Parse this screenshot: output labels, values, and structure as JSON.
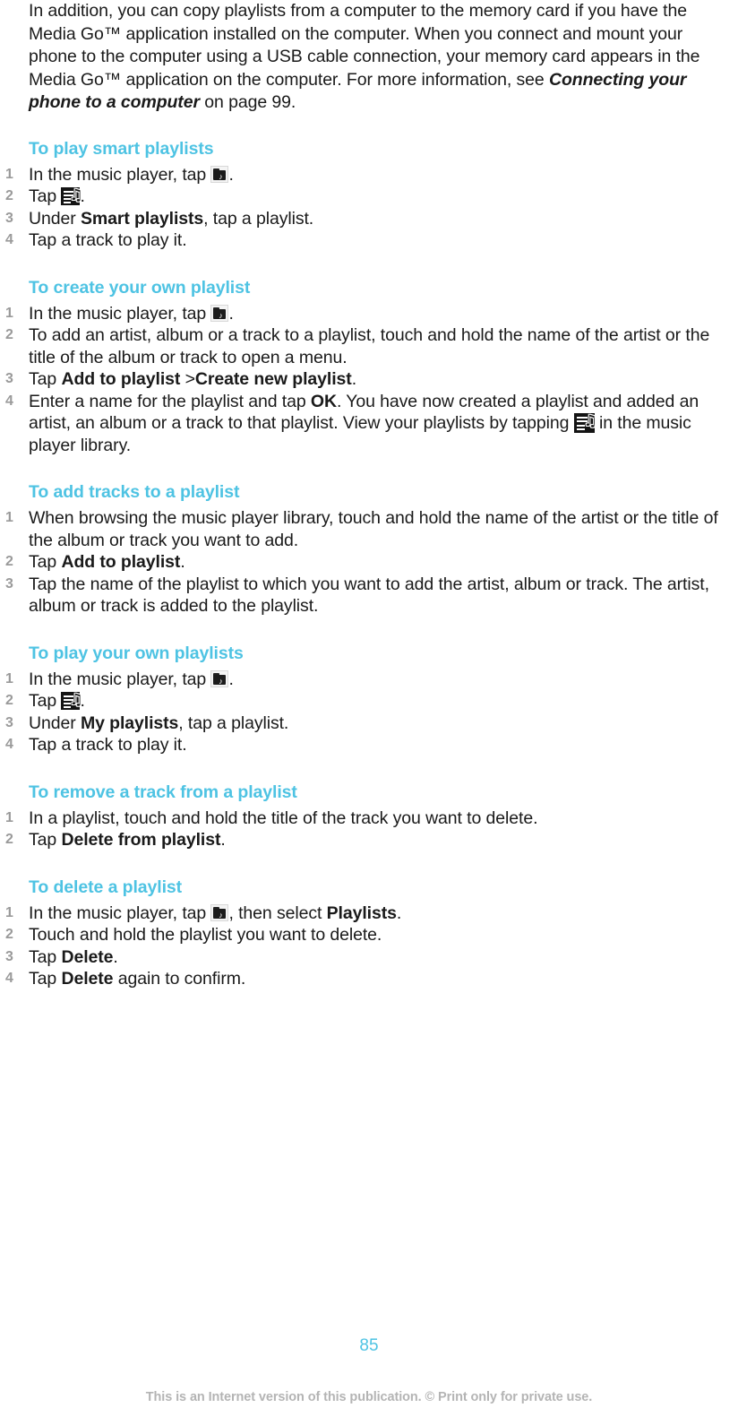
{
  "document": {
    "intro": {
      "text_part1": "In addition, you can copy playlists from a computer to the memory card if you have the Media Go™ application installed on the computer. When you connect and mount your phone to the computer using a USB cable connection, your memory card appears in the Media Go™ application on the computer. For more information, see ",
      "italic_ref": "Connecting your phone to a computer",
      "text_part2": " on page 99."
    },
    "sections": [
      {
        "title": "To play smart playlists",
        "steps": [
          {
            "pre": "In the music player, tap ",
            "icon": "music-folder-icon",
            "post": "."
          },
          {
            "pre": "Tap ",
            "icon": "playlist-icon",
            "post": "."
          },
          {
            "pre": "Under ",
            "bold": "Smart playlists",
            "post": ", tap a playlist."
          },
          {
            "pre": "Tap a track to play it."
          }
        ]
      },
      {
        "title": "To create your own playlist",
        "steps": [
          {
            "pre": "In the music player, tap ",
            "icon": "music-folder-icon",
            "post": "."
          },
          {
            "pre": "To add an artist, album or a track to a playlist, touch and hold the name of the artist or the title of the album or track to open a menu."
          },
          {
            "pre": "Tap ",
            "bold": "Add to playlist",
            "mid": " >",
            "bold2": "Create new playlist",
            "post": "."
          },
          {
            "pre": "Enter a name for the playlist and tap ",
            "bold": "OK",
            "post": ". You have now created a playlist and added an artist, an album or a track to that playlist. View your playlists by tapping ",
            "icon_end": "playlist-icon",
            "post2": " in the music player library."
          }
        ]
      },
      {
        "title": "To add tracks to a playlist",
        "steps": [
          {
            "pre": "When browsing the music player library, touch and hold the name of the artist or the title of the album or track you want to add."
          },
          {
            "pre": "Tap ",
            "bold": "Add to playlist",
            "post": "."
          },
          {
            "pre": "Tap the name of the playlist to which you want to add the artist, album or track. The artist, album or track is added to the playlist."
          }
        ]
      },
      {
        "title": "To play your own playlists",
        "steps": [
          {
            "pre": "In the music player, tap ",
            "icon": "music-folder-icon",
            "post": "."
          },
          {
            "pre": "Tap ",
            "icon": "playlist-icon",
            "post": "."
          },
          {
            "pre": "Under ",
            "bold": "My playlists",
            "post": ", tap a playlist."
          },
          {
            "pre": "Tap a track to play it."
          }
        ]
      },
      {
        "title": "To remove a track from a playlist",
        "steps": [
          {
            "pre": "In a playlist, touch and hold the title of the track you want to delete."
          },
          {
            "pre": "Tap ",
            "bold": "Delete from playlist",
            "post": "."
          }
        ]
      },
      {
        "title": "To delete a playlist",
        "steps": [
          {
            "pre": "In the music player, tap ",
            "icon": "music-folder-icon",
            "post": ", then select ",
            "bold_end": "Playlists",
            "post2": "."
          },
          {
            "pre": "Touch and hold the playlist you want to delete."
          },
          {
            "pre": "Tap ",
            "bold": "Delete",
            "post": "."
          },
          {
            "pre": "Tap ",
            "bold": "Delete",
            "post": " again to confirm."
          }
        ]
      }
    ],
    "footer": {
      "page_number": "85",
      "note": "This is an Internet version of this publication. © Print only for private use."
    },
    "colors": {
      "heading": "#4ec3e3",
      "body": "#1a1a1a",
      "step_number": "#9a9a9a",
      "footer_note": "#b4b4b4"
    }
  }
}
